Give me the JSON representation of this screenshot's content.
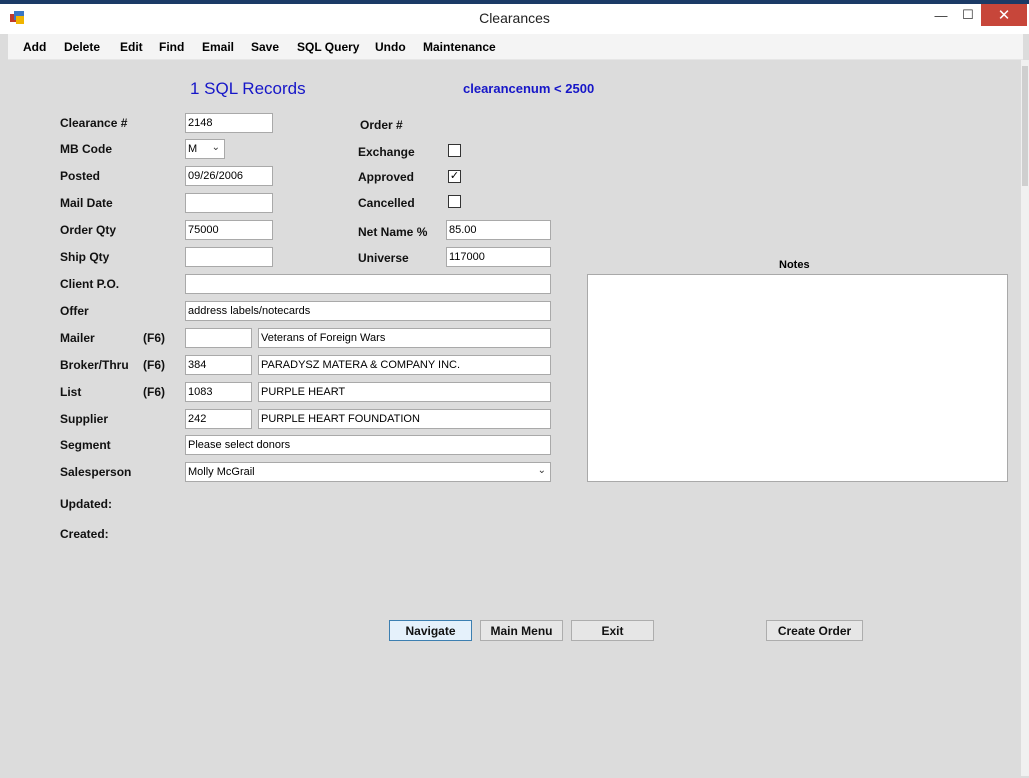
{
  "window": {
    "title": "Clearances",
    "min_glyph": "—",
    "max_glyph": "☐",
    "close_glyph": "✕"
  },
  "menu": [
    "Add",
    "Delete",
    "Edit",
    "Find",
    "Email",
    "Save",
    "SQL Query",
    "Undo",
    "Maintenance"
  ],
  "header": {
    "records": "1 SQL Records",
    "query": "clearancenum < 2500"
  },
  "labels": {
    "clearance": "Clearance #",
    "mb_code": "MB Code",
    "posted": "Posted",
    "mail_date": "Mail Date",
    "order_qty": "Order Qty",
    "ship_qty": "Ship Qty",
    "client_po": "Client P.O.",
    "offer": "Offer",
    "mailer": "Mailer",
    "broker": "Broker/Thru",
    "list": "List",
    "supplier": "Supplier",
    "segment": "Segment",
    "salesperson": "Salesperson",
    "updated": "Updated:",
    "created": "Created:",
    "order_num": "Order #",
    "exchange": "Exchange",
    "approved": "Approved",
    "cancelled": "Cancelled",
    "net_name": "Net Name %",
    "universe": "Universe",
    "notes": "Notes",
    "f6": "(F6)"
  },
  "values": {
    "clearance": "2148",
    "mb_code": "M",
    "posted": "09/26/2006",
    "mail_date": "",
    "order_qty": "75000",
    "ship_qty": "",
    "client_po": "",
    "offer": "address labels/notecards",
    "mailer_code": "",
    "mailer_name": "Veterans of Foreign Wars",
    "broker_code": "384",
    "broker_name": "PARADYSZ MATERA & COMPANY INC.",
    "list_code": "1083",
    "list_name": "PURPLE HEART",
    "supplier_code": "242",
    "supplier_name": "PURPLE HEART FOUNDATION",
    "segment": "Please select donors",
    "salesperson": "Molly McGrail",
    "net_name": "85.00",
    "universe": "117000",
    "notes": ""
  },
  "checks": {
    "exchange": false,
    "approved": true,
    "cancelled": false,
    "check_glyph": "✓"
  },
  "buttons": {
    "navigate": "Navigate",
    "main_menu": "Main Menu",
    "exit": "Exit",
    "create_order": "Create Order"
  },
  "colors": {
    "accent_blue": "#1616c8",
    "close_red": "#c7463a"
  }
}
